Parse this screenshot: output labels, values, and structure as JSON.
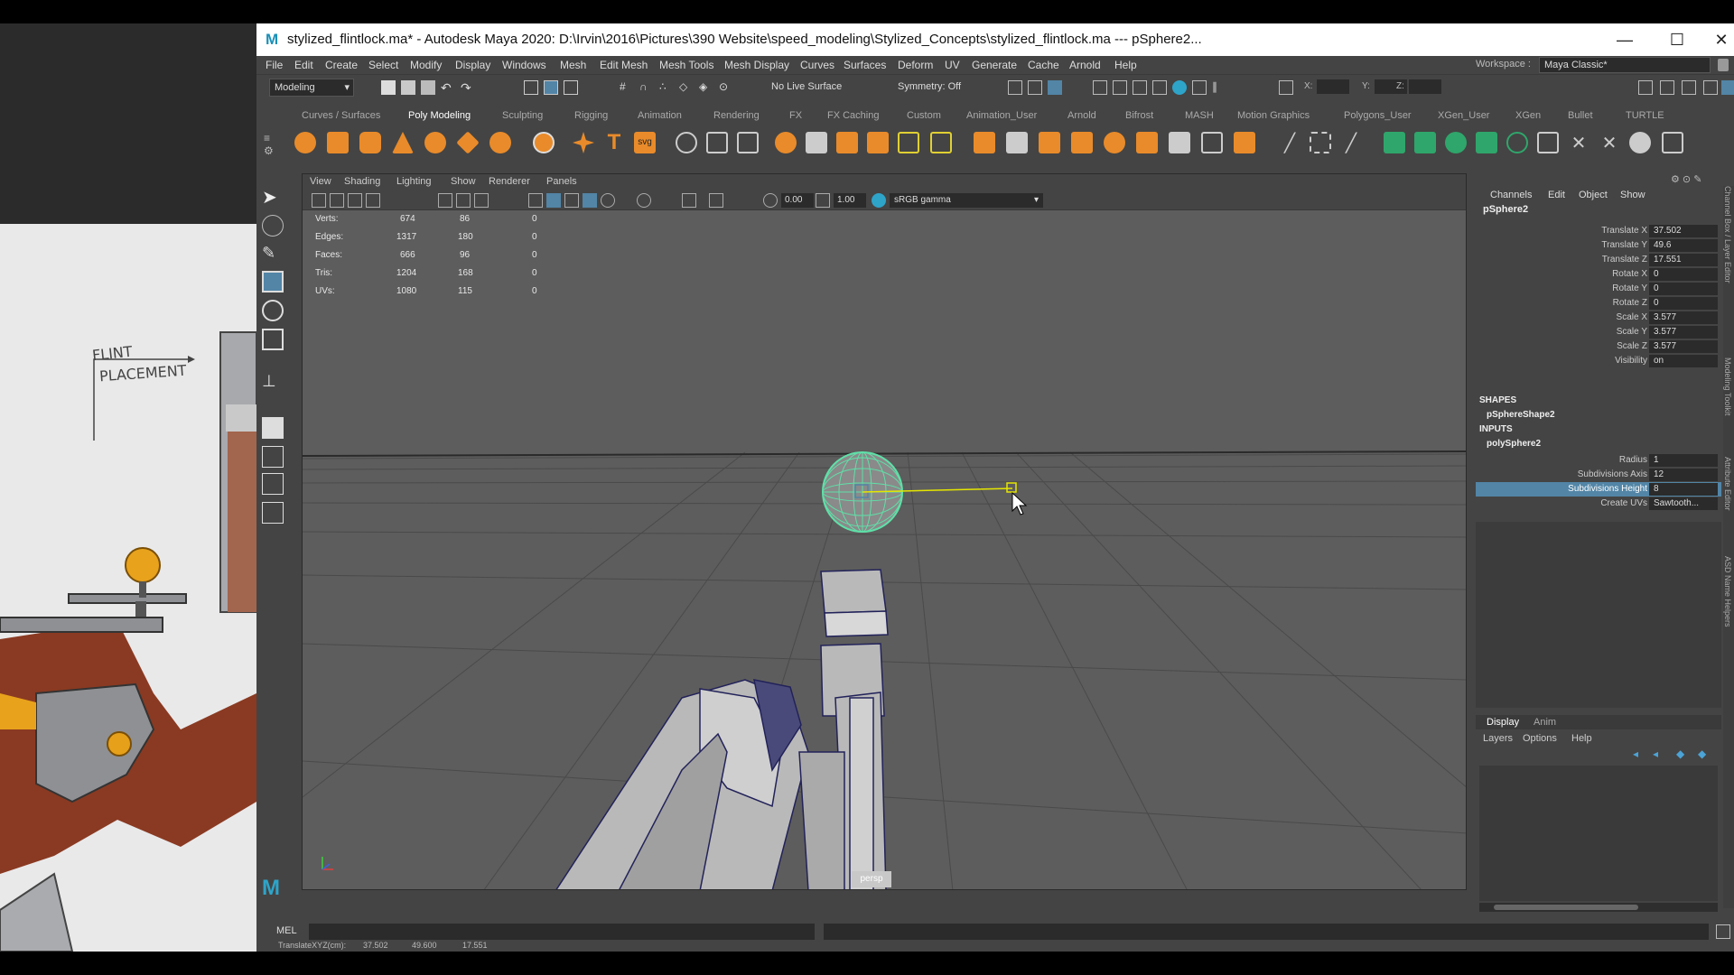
{
  "window": {
    "title": "stylized_flintlock.ma* - Autodesk Maya 2020: D:\\Irvin\\2016\\Pictures\\390 Website\\speed_modeling\\Stylized_Concepts\\stylized_flintlock.ma   ---   pSphere2...",
    "minimize": "—",
    "maximize": "☐",
    "close": "✕"
  },
  "concept_sketch": {
    "annotation_line1": "FLINT",
    "annotation_line2": "PLACEMENT"
  },
  "menu": [
    "File",
    "Edit",
    "Create",
    "Select",
    "Modify",
    "Display",
    "Windows",
    "Mesh",
    "Edit Mesh",
    "Mesh Tools",
    "Mesh Display",
    "Curves",
    "Surfaces",
    "Deform",
    "UV",
    "Generate",
    "Cache",
    "Arnold",
    "Help"
  ],
  "workspace": {
    "label": "Workspace :",
    "value": "Maya Classic*"
  },
  "status_line": {
    "mode": "Modeling",
    "live_surface": "No Live Surface",
    "symmetry": "Symmetry: Off",
    "x_label": "X:",
    "y_label": "Y:",
    "z_label": "Z:"
  },
  "shelf_tabs": [
    "Curves / Surfaces",
    "Poly Modeling",
    "Sculpting",
    "Rigging",
    "Animation",
    "Rendering",
    "FX",
    "FX Caching",
    "Custom",
    "Animation_User",
    "Arnold",
    "Bifrost",
    "MASH",
    "Motion Graphics",
    "Polygons_User",
    "XGen_User",
    "XGen",
    "Bullet",
    "TURTLE"
  ],
  "shelf_active": "Poly Modeling",
  "viewport": {
    "menu": [
      "View",
      "Shading",
      "Lighting",
      "Show",
      "Renderer",
      "Panels"
    ],
    "exposure": "0.00",
    "gamma": "1.00",
    "color_space": "sRGB gamma",
    "camera_label": "persp",
    "hud": [
      {
        "label": "Verts:",
        "a": "674",
        "b": "86",
        "c": "0"
      },
      {
        "label": "Edges:",
        "a": "1317",
        "b": "180",
        "c": "0"
      },
      {
        "label": "Faces:",
        "a": "666",
        "b": "96",
        "c": "0"
      },
      {
        "label": "Tris:",
        "a": "1204",
        "b": "168",
        "c": "0"
      },
      {
        "label": "UVs:",
        "a": "1080",
        "b": "115",
        "c": "0"
      }
    ]
  },
  "channel_box": {
    "menu": [
      "Channels",
      "Edit",
      "Object",
      "Show"
    ],
    "object": "pSphere2",
    "attributes": [
      {
        "label": "Translate X",
        "value": "37.502"
      },
      {
        "label": "Translate Y",
        "value": "49.6"
      },
      {
        "label": "Translate Z",
        "value": "17.551"
      },
      {
        "label": "Rotate X",
        "value": "0"
      },
      {
        "label": "Rotate Y",
        "value": "0"
      },
      {
        "label": "Rotate Z",
        "value": "0"
      },
      {
        "label": "Scale X",
        "value": "3.577"
      },
      {
        "label": "Scale Y",
        "value": "3.577"
      },
      {
        "label": "Scale Z",
        "value": "3.577"
      },
      {
        "label": "Visibility",
        "value": "on"
      }
    ],
    "shapes_header": "SHAPES",
    "shape": "pSphereShape2",
    "inputs_header": "INPUTS",
    "input": "polySphere2",
    "input_attributes": [
      {
        "label": "Radius",
        "value": "1"
      },
      {
        "label": "Subdivisions Axis",
        "value": "12"
      },
      {
        "label": "Subdivisions Height",
        "value": "8",
        "selected": true
      },
      {
        "label": "Create UVs",
        "value": "Sawtooth..."
      }
    ]
  },
  "side_tabs": [
    "Channel Box / Layer Editor",
    "Modeling Toolkit",
    "Attribute Editor",
    "ASD Name Helpers"
  ],
  "layer_editor": {
    "tabs": [
      "Display",
      "Anim"
    ],
    "menu": [
      "Layers",
      "Options",
      "Help"
    ]
  },
  "command_line": {
    "label": "MEL"
  },
  "help_line": {
    "label": "TranslateXYZ(cm):",
    "x": "37.502",
    "y": "49.600",
    "z": "17.551"
  },
  "colors": {
    "accent": "#5285a6",
    "selection": "#5285a6",
    "sphere_wire": "#5fe0a8",
    "manip_line": "#e6e600",
    "mesh_wire": "#22225a"
  }
}
